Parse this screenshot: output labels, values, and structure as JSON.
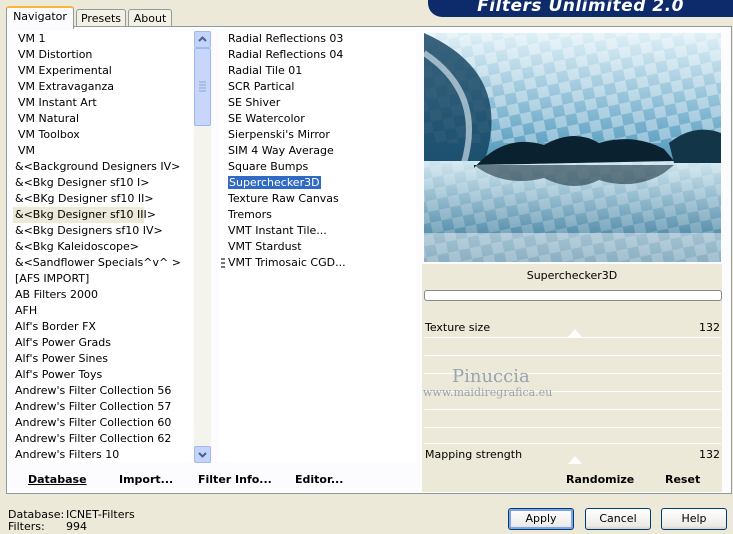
{
  "title": "Filters Unlimited 2.0",
  "tabs": [
    "Navigator",
    "Presets",
    "About"
  ],
  "categories": [
    "VM 1",
    "VM Distortion",
    "VM Experimental",
    "VM Extravaganza",
    "VM Instant Art",
    "VM Natural",
    "VM Toolbox",
    "VM",
    "&<Background Designers IV>",
    "&<Bkg Designer sf10 I>",
    "&<BKg Designer sf10 II>",
    "&<Bkg Designer sf10 III>",
    "&<Bkg Designers sf10 IV>",
    "&<Bkg Kaleidoscope>",
    "&<Sandflower Specials^v^ >",
    "[AFS IMPORT]",
    "AB Filters 2000",
    "AFH",
    "Alf's Border FX",
    "Alf's Power Grads",
    "Alf's Power Sines",
    "Alf's Power Toys",
    "Andrew's Filter Collection 56",
    "Andrew's Filter Collection 57",
    "Andrew's Filter Collection 60",
    "Andrew's Filter Collection 62",
    "Andrew's Filters 10"
  ],
  "filters": [
    "Radial Reflections 03",
    "Radial Reflections 04",
    "Radial Tile 01",
    "SCR  Partical",
    "SE Shiver",
    "SE Watercolor",
    "Sierpenski's Mirror",
    "SIM 4 Way Average",
    "Square Bumps",
    "Superchecker3D",
    "Texture Raw Canvas",
    "Tremors",
    "VMT Instant Tile...",
    "VMT Stardust",
    "VMT Trimosaic CGD..."
  ],
  "selected_filter_name": "Superchecker3D",
  "params": {
    "texture_label": "Texture size",
    "texture_value": "132",
    "mapping_label": "Mapping strength",
    "mapping_value": "132"
  },
  "watermark": {
    "name": "Pinuccia",
    "url": "www.maidiregrafica.eu"
  },
  "left_buttons": {
    "database": "Database",
    "import": "Import...",
    "filter_info": "Filter Info...",
    "editor": "Editor..."
  },
  "right_buttons": {
    "randomize": "Randomize",
    "reset": "Reset"
  },
  "status": {
    "db_label": "Database:",
    "db_value": "ICNET-Filters",
    "filters_label": "Filters:",
    "filters_value": "994"
  },
  "dialog_buttons": {
    "apply": "Apply",
    "cancel": "Cancel",
    "help": "Help"
  }
}
